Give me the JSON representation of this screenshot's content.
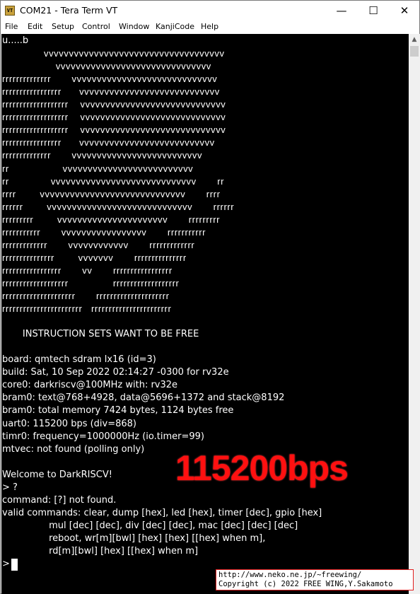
{
  "window": {
    "title": "COM21 - Tera Term VT",
    "icon_label": "VT",
    "controls": {
      "minimize": "—",
      "maximize": "☐",
      "close": "✕"
    }
  },
  "menu": [
    "File",
    "Edit",
    "Setup",
    "Control",
    "Window",
    "KanjiCode",
    "Help"
  ],
  "terminal": {
    "lines": [
      "u.....b",
      "              vvvvvvvvvvvvvvvvvvvvvvvvvvvvvvvvvvvv",
      "                  vvvvvvvvvvvvvvvvvvvvvvvvvvvvvvv",
      "rrrrrrrrrrrrrr       vvvvvvvvvvvvvvvvvvvvvvvvvvvvv",
      "rrrrrrrrrrrrrrrrr      vvvvvvvvvvvvvvvvvvvvvvvvvvvv",
      "rrrrrrrrrrrrrrrrrrr    vvvvvvvvvvvvvvvvvvvvvvvvvvvvv",
      "rrrrrrrrrrrrrrrrrrr    vvvvvvvvvvvvvvvvvvvvvvvvvvvvv",
      "rrrrrrrrrrrrrrrrrrr    vvvvvvvvvvvvvvvvvvvvvvvvvvvvv",
      "rrrrrrrrrrrrrrrrr      vvvvvvvvvvvvvvvvvvvvvvvvvvv",
      "rrrrrrrrrrrrrr       vvvvvvvvvvvvvvvvvvvvvvvvvv",
      "rr                  vvvvvvvvvvvvvvvvvvvvvvvvvv",
      "rr              vvvvvvvvvvvvvvvvvvvvvvvvvvvvv       rr",
      "rrrr        vvvvvvvvvvvvvvvvvvvvvvvvvvvvv       rrrr",
      "rrrrrr        vvvvvvvvvvvvvvvvvvvvvvvvvvvvv       rrrrrr",
      "rrrrrrrrr        vvvvvvvvvvvvvvvvvvvvvv       rrrrrrrrr",
      "rrrrrrrrrrr       vvvvvvvvvvvvvvvvv       rrrrrrrrrrr",
      "rrrrrrrrrrrrr       vvvvvvvvvvvv       rrrrrrrrrrrrr",
      "rrrrrrrrrrrrrrr        vvvvvvv       rrrrrrrrrrrrrrr",
      "rrrrrrrrrrrrrrrrr       vv       rrrrrrrrrrrrrrrrr",
      "rrrrrrrrrrrrrrrrrrr               rrrrrrrrrrrrrrrrrrr",
      "rrrrrrrrrrrrrrrrrrrrr       rrrrrrrrrrrrrrrrrrrrr",
      "rrrrrrrrrrrrrrrrrrrrrrr   rrrrrrrrrrrrrrrrrrrrrrr",
      "",
      "       INSTRUCTION SETS WANT TO BE FREE",
      "",
      "board: qmtech sdram lx16 (id=3)",
      "build: Sat, 10 Sep 2022 02:14:27 -0300 for rv32e",
      "core0: darkriscv@100MHz with: rv32e",
      "bram0: text@768+4928, data@5696+1372 and stack@8192",
      "bram0: total memory 7424 bytes, 1124 bytes free",
      "uart0: 115200 bps (div=868)",
      "timr0: frequency=1000000Hz (io.timer=99)",
      "mtvec: not found (polling only)",
      "",
      "Welcome to DarkRISCV!",
      "> ?",
      "command: [?] not found.",
      "valid commands: clear, dump [hex], led [hex], timer [dec], gpio [hex]",
      "                mul [dec] [dec], div [dec] [dec], mac [dec] [dec] [dec]",
      "                reboot, wr[m][bwl] [hex] [hex] [[hex] when m],",
      "                rd[m][bwl] [hex] [[hex] when m]",
      "> "
    ]
  },
  "overlay": {
    "bps_label": "115200bps",
    "credit_line1": "http://www.neko.ne.jp/~freewing/",
    "credit_line2": "Copyright (c) 2022 FREE WING,Y.Sakamoto"
  },
  "colors": {
    "terminal_bg": "#000000",
    "terminal_fg": "#ffffff",
    "overlay_red": "#ff1010"
  }
}
